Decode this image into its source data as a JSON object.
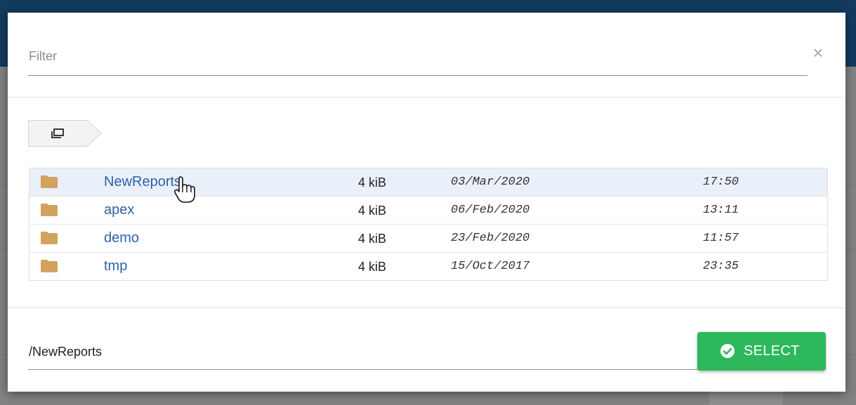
{
  "colors": {
    "link": "#2d63a8",
    "folder": "#d2a25e",
    "select_button": "#2eb85c",
    "row_highlight": "#eaf0f9"
  },
  "filter": {
    "placeholder": "Filter",
    "value": ""
  },
  "close_icon": "close-icon",
  "breadcrumb": {
    "icon": "root-folder-icon"
  },
  "files": [
    {
      "name": "NewReports",
      "size": "4 kiB",
      "date": "03/Mar/2020",
      "time": "17:50",
      "icon": "folder-icon"
    },
    {
      "name": "apex",
      "size": "4 kiB",
      "date": "06/Feb/2020",
      "time": "13:11",
      "icon": "folder-icon"
    },
    {
      "name": "demo",
      "size": "4 kiB",
      "date": "23/Feb/2020",
      "time": "11:57",
      "icon": "folder-icon"
    },
    {
      "name": "tmp",
      "size": "4 kiB",
      "date": "15/Oct/2017",
      "time": "23:35",
      "icon": "folder-icon"
    }
  ],
  "path": {
    "value": "/NewReports"
  },
  "select_button": {
    "label": "SELECT",
    "icon": "check-circle-icon"
  }
}
